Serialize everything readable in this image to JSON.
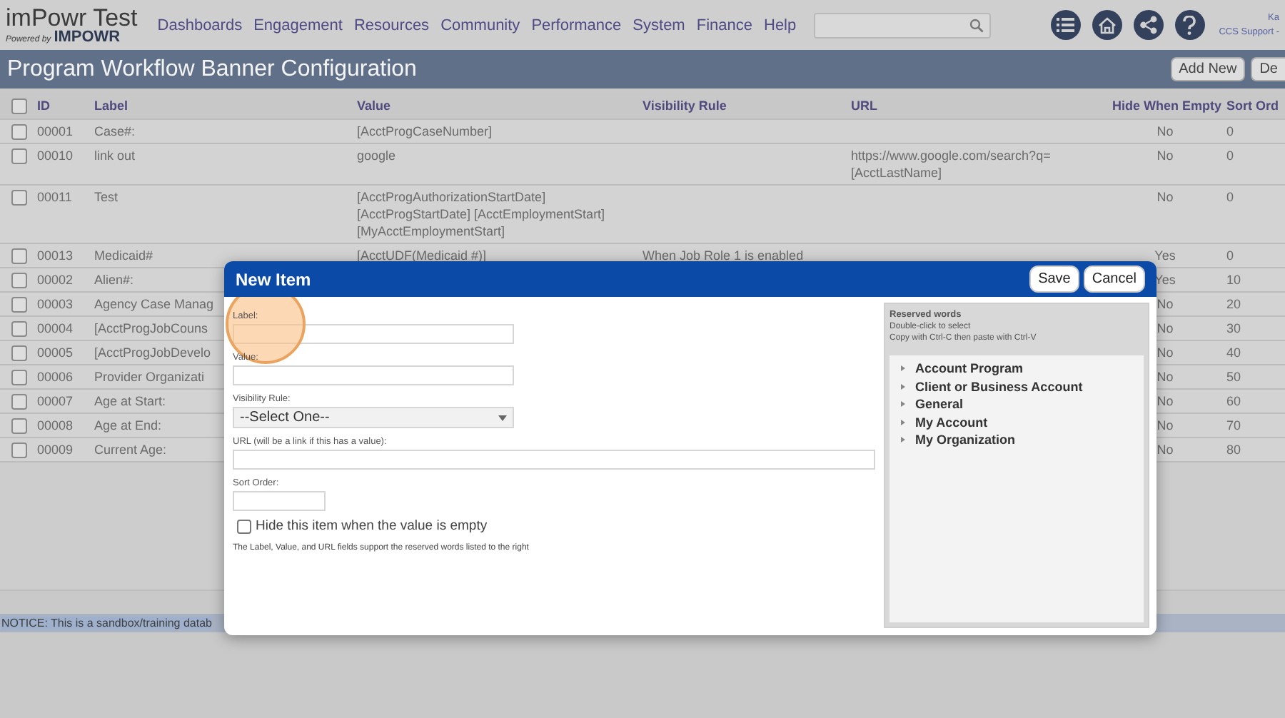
{
  "app": {
    "title": "imPowr Test",
    "powered_by": "Powered by",
    "brand": "IMPOWR"
  },
  "nav": [
    "Dashboards",
    "Engagement",
    "Resources",
    "Community",
    "Performance",
    "System",
    "Finance",
    "Help"
  ],
  "user": {
    "name": "Ka",
    "role": "CCS Support -"
  },
  "page": {
    "title": "Program Workflow Banner Configuration",
    "buttons": [
      "Add New",
      "De"
    ]
  },
  "table": {
    "select_all_checked": false,
    "columns": [
      "ID",
      "Label",
      "Value",
      "Visibility Rule",
      "URL",
      "Hide When Empty",
      "Sort Ord"
    ],
    "rows": [
      {
        "checked": false,
        "id": "00001",
        "label": "Case#:",
        "value": "[AcctProgCaseNumber]",
        "hide_when_empty": "No",
        "sort_order": "0"
      },
      {
        "checked": false,
        "id": "00010",
        "label": "link out",
        "value": "google",
        "url": "https://www.google.com/search?q=[AcctLastName]",
        "hide_when_empty": "No",
        "sort_order": "0"
      },
      {
        "checked": false,
        "id": "00011",
        "label": "Test",
        "value": "[AcctProgAuthorizationStartDate] [AcctProgStartDate] [AcctEmploymentStart] [MyAcctEmploymentStart]",
        "hide_when_empty": "No",
        "sort_order": "0"
      },
      {
        "checked": false,
        "id": "00013",
        "label": "Medicaid#",
        "value": "[AcctUDF(Medicaid #)]",
        "visibility_rule": "When Job Role 1 is enabled",
        "hide_when_empty": "Yes",
        "sort_order": "0"
      },
      {
        "checked": false,
        "id": "00002",
        "label": "Alien#:",
        "hide_when_empty": "Yes",
        "sort_order": "10"
      },
      {
        "checked": false,
        "id": "00003",
        "label": "Agency Case Manag",
        "hide_when_empty": "No",
        "sort_order": "20"
      },
      {
        "checked": false,
        "id": "00004",
        "label": "[AcctProgJobCouns",
        "hide_when_empty": "No",
        "sort_order": "30"
      },
      {
        "checked": false,
        "id": "00005",
        "label": "[AcctProgJobDevelo",
        "hide_when_empty": "No",
        "sort_order": "40"
      },
      {
        "checked": false,
        "id": "00006",
        "label": "Provider Organizati",
        "hide_when_empty": "No",
        "sort_order": "50"
      },
      {
        "checked": false,
        "id": "00007",
        "label": "Age at Start:",
        "hide_when_empty": "No",
        "sort_order": "60"
      },
      {
        "checked": false,
        "id": "00008",
        "label": "Age at End:",
        "hide_when_empty": "No",
        "sort_order": "70"
      },
      {
        "checked": false,
        "id": "00009",
        "label": "Current Age:",
        "hide_when_empty": "No",
        "sort_order": "80"
      }
    ]
  },
  "notice": "NOTICE: This is a sandbox/training datab",
  "dialog": {
    "title": "New Item",
    "buttons": [
      "Save",
      "Cancel"
    ],
    "fields": [
      {
        "kind": "text",
        "label": "Label:"
      },
      {
        "kind": "text",
        "label": "Value:"
      },
      {
        "kind": "select",
        "label": "Visibility Rule:",
        "value": "--Select One--"
      },
      {
        "kind": "wide",
        "label": "URL (will be a link if this has a value):"
      },
      {
        "kind": "short",
        "label": "Sort Order:"
      }
    ],
    "hide_checkbox": {
      "label": "Hide this item when the value is empty",
      "checked": false
    },
    "help": "The Label, Value, and URL fields support the reserved words listed to the right",
    "reserved": {
      "title": "Reserved words",
      "hints": [
        "Double-click to select",
        "Copy with Ctrl-C then paste with Ctrl-V"
      ],
      "groups": [
        {
          "label": "Account Program",
          "expanded": false
        },
        {
          "label": "Client or Business Account",
          "expanded": false
        },
        {
          "label": "General",
          "expanded": false
        },
        {
          "label": "My Account",
          "expanded": false
        },
        {
          "label": "My Organization",
          "expanded": false
        }
      ]
    }
  }
}
